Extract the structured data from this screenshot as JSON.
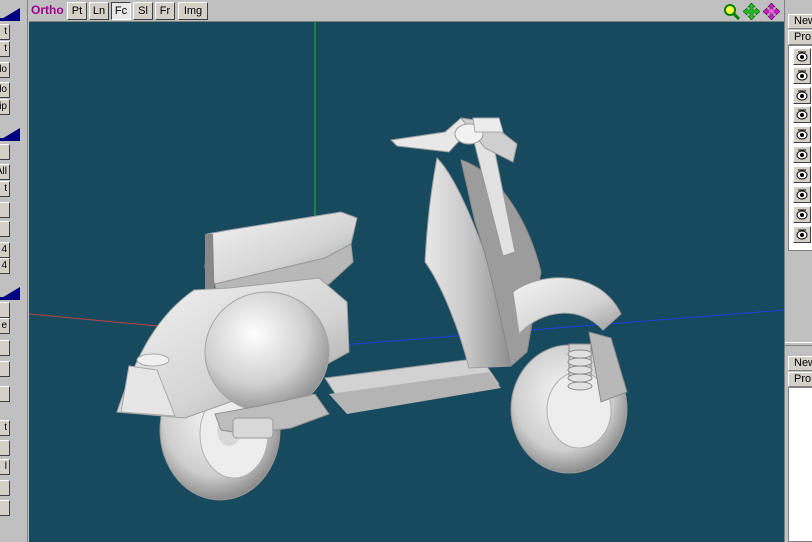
{
  "viewport": {
    "mode_label": "Ortho",
    "buttons": [
      {
        "label": "Pt",
        "pressed": false
      },
      {
        "label": "Ln",
        "pressed": false
      },
      {
        "label": "Fc",
        "pressed": true
      },
      {
        "label": "Sl",
        "pressed": false
      },
      {
        "label": "Fr",
        "pressed": false
      },
      {
        "label": "Img",
        "pressed": false
      }
    ],
    "icons": [
      "zoom-icon",
      "pan-icon",
      "rotate-icon"
    ],
    "background_color": "#174a5e",
    "axis_colors": {
      "x": "#c04040",
      "y": "#20c020",
      "z": "#2040e0"
    }
  },
  "left_panel": {
    "tool_buttons": [
      "t",
      "t",
      "lo",
      "lo",
      "ip",
      "",
      "All",
      "t",
      "",
      "",
      "4",
      "4",
      "",
      "e",
      "",
      "",
      "",
      "t",
      "",
      "l",
      "",
      ""
    ]
  },
  "right_panel": {
    "top_list": {
      "new_label": "New",
      "props_label": "Pro",
      "visible_toggles": 10
    },
    "bottom_list": {
      "new_label": "New",
      "props_label": "Pro"
    }
  }
}
